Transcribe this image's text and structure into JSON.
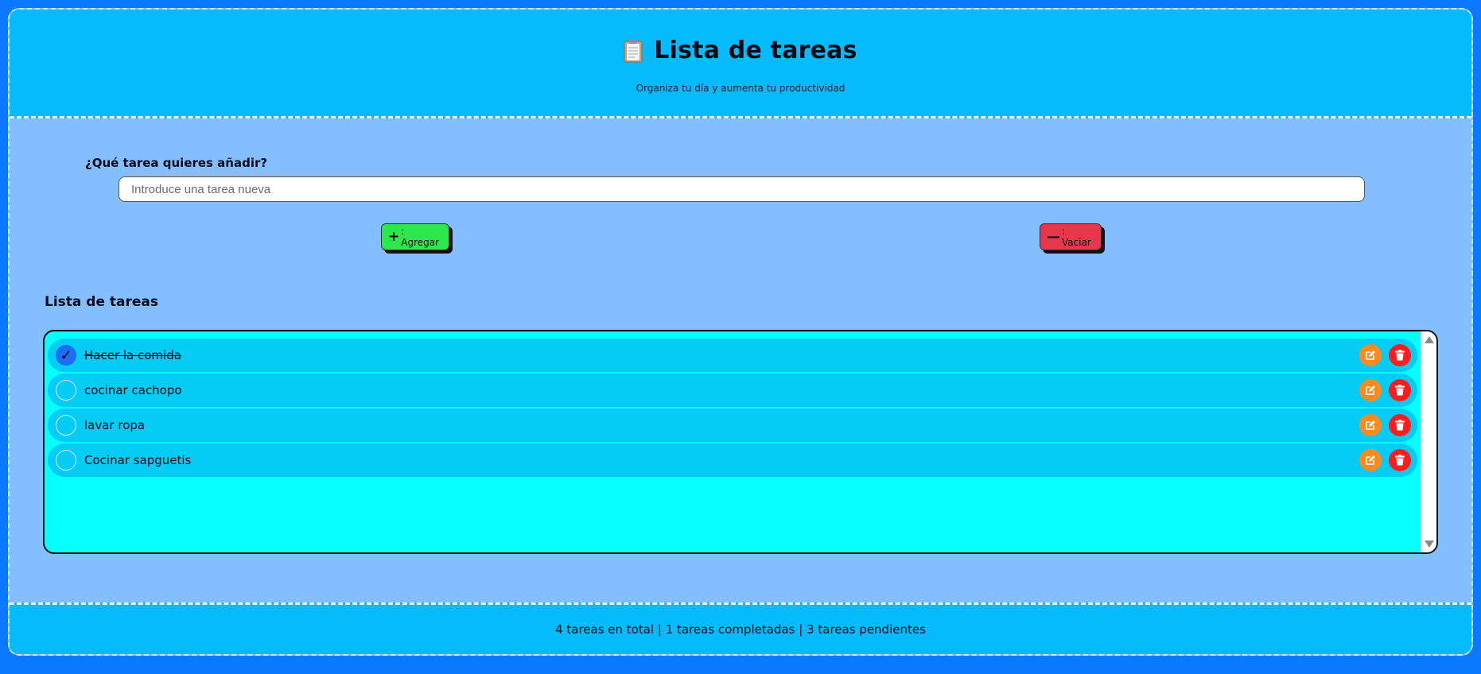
{
  "header": {
    "title": "Lista de tareas",
    "subtitle": "Organiza tu día y aumenta tu productividad",
    "icon": "clipboard-icon"
  },
  "form": {
    "label": "¿Qué tarea quieres añadir?",
    "placeholder": "Introduce una tarea nueva",
    "value": "",
    "add_symbol": "+",
    "add_label": ": Agregar",
    "clear_symbol": "—",
    "clear_label": ": Vaciar"
  },
  "list": {
    "heading": "Lista de tareas",
    "tasks": [
      {
        "text": "Hacer la comida",
        "completed": true
      },
      {
        "text": "cocinar cachopo",
        "completed": false
      },
      {
        "text": "lavar ropa",
        "completed": false
      },
      {
        "text": "Cocinar sapguetis",
        "completed": false
      }
    ]
  },
  "footer": {
    "summary": "4 tareas en total | 1 tareas completadas | 3 tareas pendientes"
  },
  "colors": {
    "page_bg": "#0a78ff",
    "header_bg": "#05bbfb",
    "main_bg": "#83bffe",
    "list_bg": "#06ffff",
    "task_bg": "#05ccf5",
    "add_button": "#2ee84b",
    "clear_button": "#e8364d",
    "edit_button": "#ff8a1c",
    "delete_button": "#ff1c1c",
    "check_done": "#1c6ef7"
  }
}
